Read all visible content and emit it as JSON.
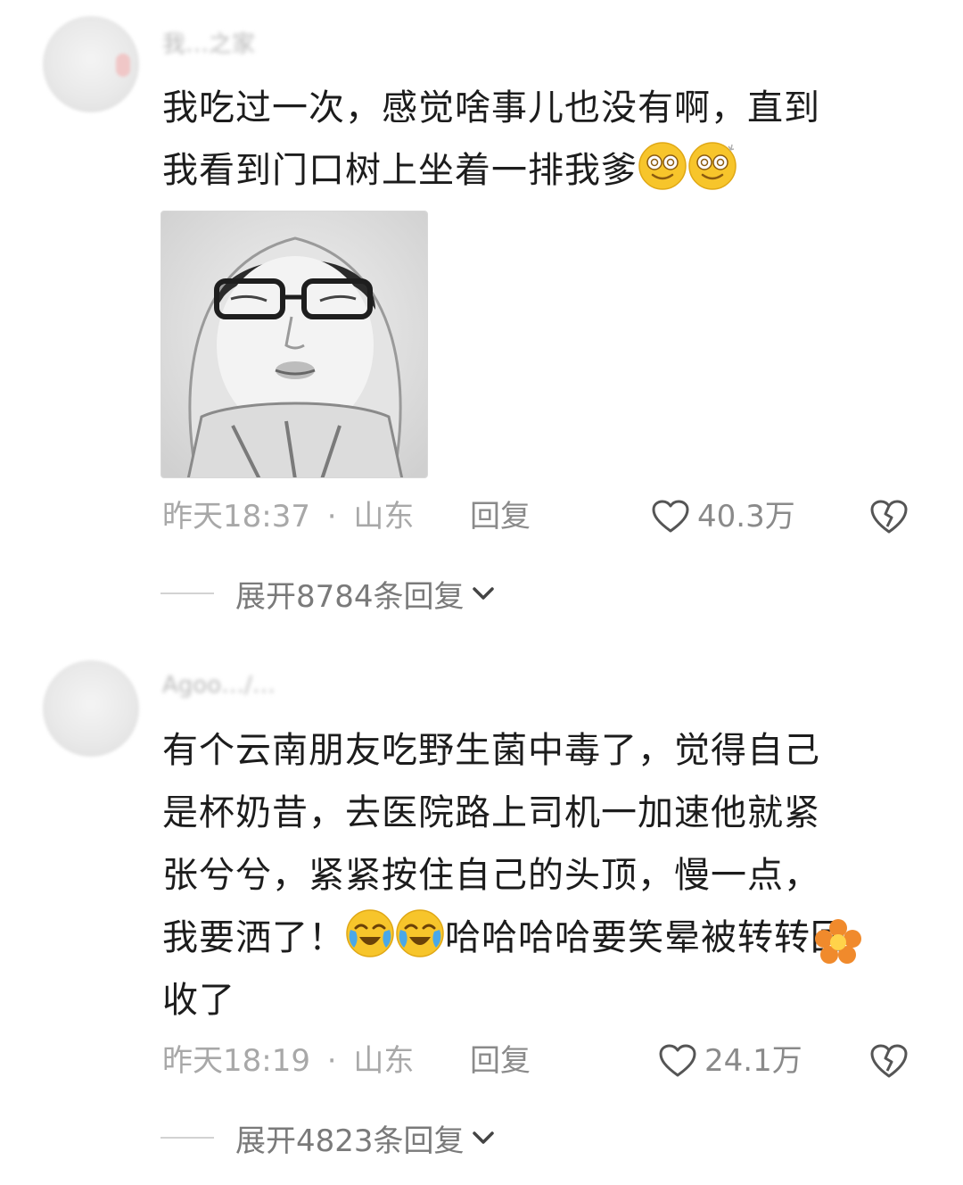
{
  "comments": [
    {
      "username": "我…之家",
      "text_line1": "我吃过一次，感觉啥事儿也没有啊，直到",
      "text_line2": "我看到门口树上坐着一排我爹",
      "emojis": [
        "dizzy-face-emoji",
        "dizzy-face-emoji"
      ],
      "image_icon": "portrait-photo",
      "time": "昨天18:37",
      "location": "山东",
      "separator": "·",
      "reply_label": "回复",
      "likes": "40.3万",
      "expand_label": "展开8784条回复"
    },
    {
      "username": "Agoo…/…",
      "text_line1": "有个云南朋友吃野生菌中毒了，觉得自己",
      "text_line2": "是杯奶昔，去医院路上司机一加速他就紧",
      "text_line3": "张兮兮，紧紧按住自己的头顶，慢一点，",
      "text_line4_before": "我要洒了！",
      "text_line4_after": "哈哈哈哈要笑晕被转转回",
      "text_line5": "收了",
      "emojis": [
        "crying-laughing-emoji",
        "crying-laughing-emoji"
      ],
      "time": "昨天18:19",
      "location": "山东",
      "separator": "·",
      "reply_label": "回复",
      "likes": "24.1万",
      "expand_label": "展开4823条回复"
    }
  ],
  "colors": {
    "text": "#1c1c1c",
    "meta": "#a8a8a8",
    "expand": "#7a7a7a",
    "emoji_yellow": "#f7c52b",
    "flower_orange": "#f08a2c"
  }
}
